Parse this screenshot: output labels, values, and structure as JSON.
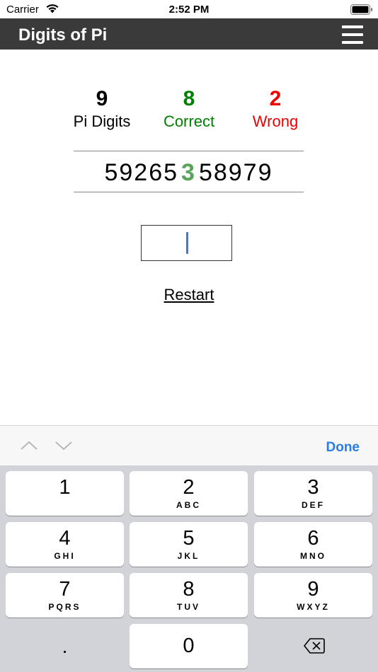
{
  "status_bar": {
    "carrier": "Carrier",
    "time": "2:52 PM"
  },
  "nav": {
    "title": "Digits of Pi"
  },
  "stats": {
    "digits": {
      "value": "9",
      "label": "Pi Digits"
    },
    "correct": {
      "value": "8",
      "label": "Correct"
    },
    "wrong": {
      "value": "2",
      "label": "Wrong"
    }
  },
  "sequence": {
    "before": "59265",
    "current": "3",
    "after": "58979"
  },
  "answer_input": {
    "value": ""
  },
  "restart_label": "Restart",
  "accessory": {
    "done_label": "Done"
  },
  "keypad": {
    "keys": [
      {
        "num": "1",
        "letters": ""
      },
      {
        "num": "2",
        "letters": "ABC"
      },
      {
        "num": "3",
        "letters": "DEF"
      },
      {
        "num": "4",
        "letters": "GHI"
      },
      {
        "num": "5",
        "letters": "JKL"
      },
      {
        "num": "6",
        "letters": "MNO"
      },
      {
        "num": "7",
        "letters": "PQRS"
      },
      {
        "num": "8",
        "letters": "TUV"
      },
      {
        "num": "9",
        "letters": "WXYZ"
      }
    ],
    "dot": ".",
    "zero": "0"
  },
  "colors": {
    "nav_bg": "#3a3a3a",
    "correct": "#008000",
    "wrong": "#ee0000",
    "highlight_digit": "#5aa45a",
    "caret": "#3478f6",
    "done": "#2c7ce5"
  }
}
